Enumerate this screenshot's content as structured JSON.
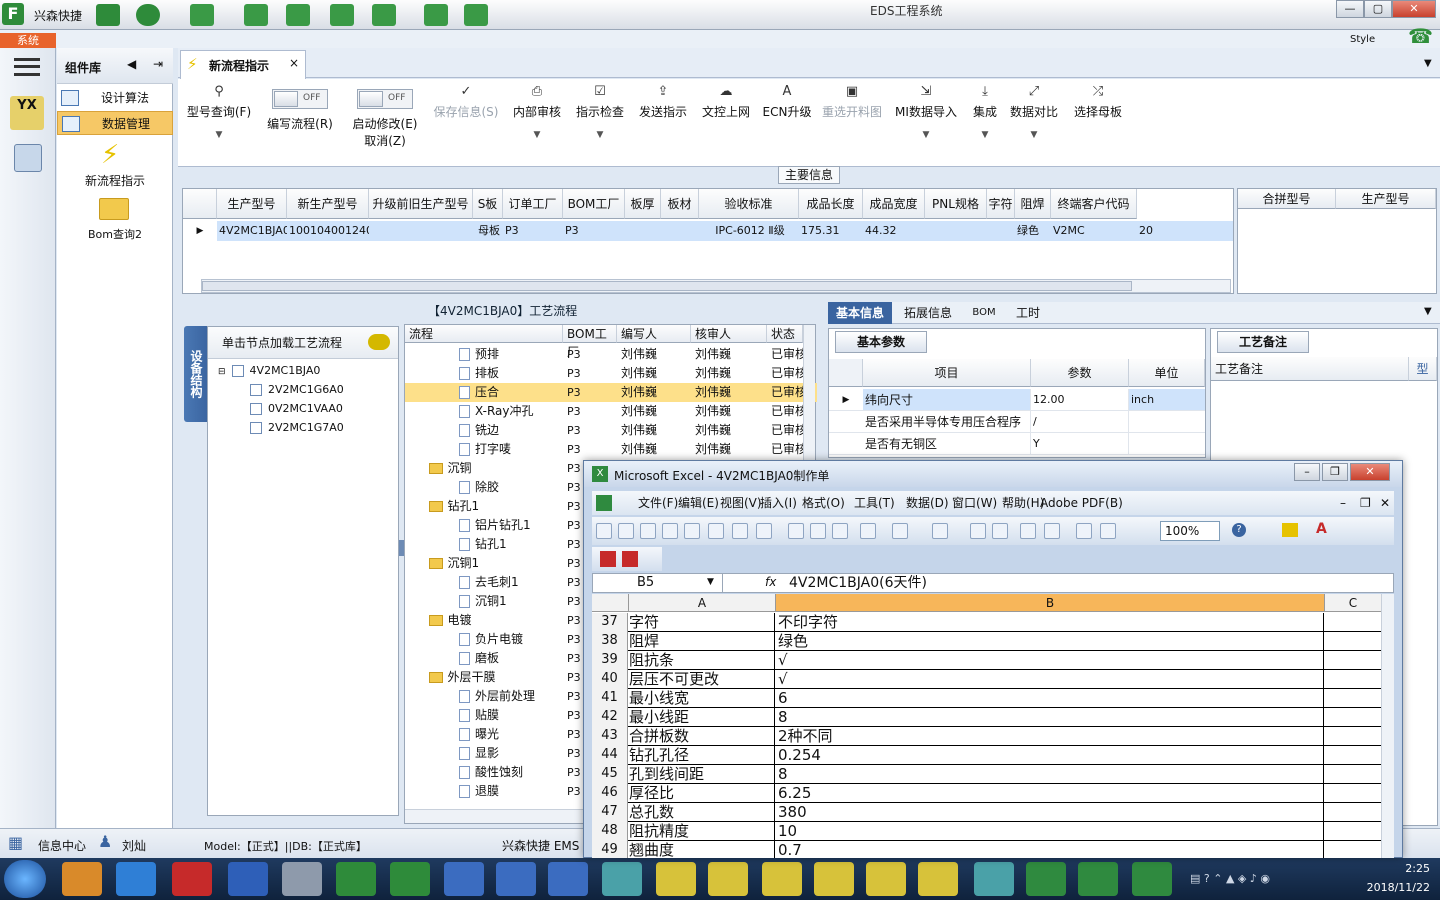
{
  "app": {
    "name": "兴森快捷",
    "window_title": "EDS工程系统",
    "system_menu": "系统",
    "style_label": "Style"
  },
  "window_controls": [
    "—",
    "▢",
    "✕"
  ],
  "sidebar": {
    "header": "组件库",
    "items": [
      {
        "label": "设计算法"
      },
      {
        "label": "数据管理"
      }
    ],
    "launchers": [
      {
        "label": "新流程指示"
      },
      {
        "label": "Bom查询2"
      }
    ]
  },
  "tab": {
    "label": "新流程指示",
    "close": "×"
  },
  "ribbon": {
    "buttons": [
      {
        "label": "型号查询(F)"
      },
      {
        "label": "编写流程(R)",
        "toggle": "OFF"
      },
      {
        "label": "启动修改(E)",
        "sub": "取消(Z)",
        "toggle": "OFF"
      },
      {
        "label": "保存信息(S)"
      },
      {
        "label": "内部审核"
      },
      {
        "label": "指示检查"
      },
      {
        "label": "发送指示"
      },
      {
        "label": "文控上网"
      },
      {
        "label": "ECN升级"
      },
      {
        "label": "重选开料图"
      },
      {
        "label": "MI数据导入"
      },
      {
        "label": "集成"
      },
      {
        "label": "数据对比"
      },
      {
        "label": "选择母板"
      }
    ]
  },
  "main_info": {
    "title": "主要信息",
    "columns": [
      "生产型号",
      "新生产型号",
      "升级前旧生产型号",
      "S板",
      "订单工厂",
      "BOM工厂",
      "板厚",
      "板材",
      "验收标准",
      "成品长度",
      "成品宽度",
      "PNL规格",
      "字符",
      "阻焊",
      "终端客户代码"
    ],
    "row": [
      "4V2MC1BJA0",
      "10010400124027",
      "",
      "母板",
      "P3",
      "P3",
      "",
      "",
      "IPC-6012 Ⅱ级",
      "175.31",
      "44.32",
      "",
      "",
      "绿色",
      "V2MC"
    ],
    "extra_cell": "20",
    "right_columns": [
      "合拼型号",
      "生产型号"
    ]
  },
  "process": {
    "title": "【4V2MC1BJA0】工艺流程",
    "side_tab": "设备结构",
    "hint": "单击节点加载工艺流程",
    "tree": {
      "root": "4V2MC1BJA0",
      "children": [
        "2V2MC1G6A0",
        "0V2MC1VAA0",
        "2V2MC1G7A0"
      ]
    },
    "columns": [
      "流程",
      "BOM工厂",
      "编写人",
      "核审人",
      "状态"
    ],
    "rows": [
      {
        "name": "预排",
        "level": 2,
        "type": "doc",
        "bom": "P3",
        "writer": "刘伟巍",
        "reviewer": "刘伟巍",
        "status": "已审核"
      },
      {
        "name": "排板",
        "level": 2,
        "type": "doc",
        "bom": "P3",
        "writer": "刘伟巍",
        "reviewer": "刘伟巍",
        "status": "已审核"
      },
      {
        "name": "压合",
        "level": 2,
        "type": "doc",
        "bom": "P3",
        "writer": "刘伟巍",
        "reviewer": "刘伟巍",
        "status": "已审核",
        "selected": true
      },
      {
        "name": "X-Ray冲孔",
        "level": 2,
        "type": "doc",
        "bom": "P3",
        "writer": "刘伟巍",
        "reviewer": "刘伟巍",
        "status": "已审核"
      },
      {
        "name": "铣边",
        "level": 2,
        "type": "doc",
        "bom": "P3",
        "writer": "刘伟巍",
        "reviewer": "刘伟巍",
        "status": "已审核"
      },
      {
        "name": "打字唛",
        "level": 2,
        "type": "doc",
        "bom": "P3",
        "writer": "刘伟巍",
        "reviewer": "刘伟巍",
        "status": "已审核"
      },
      {
        "name": "沉铜",
        "level": 1,
        "type": "folder",
        "bom": "P3",
        "writer": "",
        "reviewer": "",
        "status": ""
      },
      {
        "name": "除胶",
        "level": 2,
        "type": "doc",
        "bom": "P3",
        "writer": "",
        "reviewer": "",
        "status": ""
      },
      {
        "name": "钻孔1",
        "level": 1,
        "type": "folder",
        "bom": "P3",
        "writer": "",
        "reviewer": "",
        "status": ""
      },
      {
        "name": "铝片钻孔1",
        "level": 2,
        "type": "doc",
        "bom": "P3",
        "writer": "",
        "reviewer": "",
        "status": ""
      },
      {
        "name": "钻孔1",
        "level": 2,
        "type": "doc",
        "bom": "P3",
        "writer": "",
        "reviewer": "",
        "status": ""
      },
      {
        "name": "沉铜1",
        "level": 1,
        "type": "folder",
        "bom": "P3",
        "writer": "",
        "reviewer": "",
        "status": ""
      },
      {
        "name": "去毛刺1",
        "level": 2,
        "type": "doc",
        "bom": "P3",
        "writer": "",
        "reviewer": "",
        "status": ""
      },
      {
        "name": "沉铜1",
        "level": 2,
        "type": "doc",
        "bom": "P3",
        "writer": "",
        "reviewer": "",
        "status": ""
      },
      {
        "name": "电镀",
        "level": 1,
        "type": "folder",
        "bom": "P3",
        "writer": "",
        "reviewer": "",
        "status": ""
      },
      {
        "name": "负片电镀",
        "level": 2,
        "type": "doc",
        "bom": "P3",
        "writer": "",
        "reviewer": "",
        "status": ""
      },
      {
        "name": "磨板",
        "level": 2,
        "type": "doc",
        "bom": "P3",
        "writer": "",
        "reviewer": "",
        "status": ""
      },
      {
        "name": "外层干膜",
        "level": 1,
        "type": "folder",
        "bom": "P3",
        "writer": "",
        "reviewer": "",
        "status": ""
      },
      {
        "name": "外层前处理",
        "level": 2,
        "type": "doc",
        "bom": "P3",
        "writer": "",
        "reviewer": "",
        "status": ""
      },
      {
        "name": "贴膜",
        "level": 2,
        "type": "doc",
        "bom": "P3",
        "writer": "",
        "reviewer": "",
        "status": ""
      },
      {
        "name": "曝光",
        "level": 2,
        "type": "doc",
        "bom": "P3",
        "writer": "",
        "reviewer": "",
        "status": ""
      },
      {
        "name": "显影",
        "level": 2,
        "type": "doc",
        "bom": "P3",
        "writer": "",
        "reviewer": "",
        "status": ""
      },
      {
        "name": "酸性蚀刻",
        "level": 2,
        "type": "doc",
        "bom": "P3",
        "writer": "",
        "reviewer": "",
        "status": ""
      },
      {
        "name": "退膜",
        "level": 2,
        "type": "doc",
        "bom": "P3",
        "writer": "",
        "reviewer": "",
        "status": ""
      }
    ]
  },
  "right_panel": {
    "tabs": [
      "基本信息",
      "拓展信息",
      "BOM",
      "工时"
    ],
    "basic_title": "基本参数",
    "columns": [
      "项目",
      "参数",
      "单位"
    ],
    "rows": [
      {
        "item": "纬向尺寸",
        "param": "12.00",
        "unit": "inch"
      },
      {
        "item": "是否采用半导体专用压合程序",
        "param": "/",
        "unit": ""
      },
      {
        "item": "是否有无铜区",
        "param": "Y",
        "unit": ""
      }
    ],
    "remark_title": "工艺备注",
    "remark_header": "工艺备注",
    "remark_col2": "型"
  },
  "status_bar": {
    "info": "信息中心",
    "user": "刘灿",
    "model": "Model:【正式】||DB:【正式库】",
    "brand": "兴森快捷 EMS"
  },
  "excel": {
    "title": "Microsoft Excel - 4V2MC1BJA0制作单",
    "menu": [
      "文件(F)",
      "编辑(E)",
      "视图(V)",
      "插入(I)",
      "格式(O)",
      "工具(T)",
      "数据(D)",
      "窗口(W)",
      "帮助(H)",
      "Adobe PDF(B)"
    ],
    "zoom": "100%",
    "cell_ref": "B5",
    "formula": "4V2MC1BJA0(6天件)",
    "col_headers": [
      "A",
      "B",
      "C"
    ],
    "rows": [
      {
        "n": "37",
        "a": "字符",
        "b": "不印字符"
      },
      {
        "n": "38",
        "a": "阻焊",
        "b": "绿色"
      },
      {
        "n": "39",
        "a": "阻抗条",
        "b": "√"
      },
      {
        "n": "40",
        "a": "层压不可更改",
        "b": "√"
      },
      {
        "n": "41",
        "a": "最小线宽",
        "b": "6"
      },
      {
        "n": "42",
        "a": "最小线距",
        "b": "8"
      },
      {
        "n": "43",
        "a": "合拼板数",
        "b": "2种不同"
      },
      {
        "n": "44",
        "a": "钻孔孔径",
        "b": "0.254"
      },
      {
        "n": "45",
        "a": "孔到线间距",
        "b": "8"
      },
      {
        "n": "46",
        "a": "厚径比",
        "b": "6.25"
      },
      {
        "n": "47",
        "a": "总孔数",
        "b": "380"
      },
      {
        "n": "48",
        "a": "阻抗精度",
        "b": "10"
      },
      {
        "n": "49",
        "a": "翘曲度",
        "b": "0.7"
      }
    ]
  },
  "taskbar": {
    "time": "2:25",
    "date": "2018/11/22"
  },
  "colors": {
    "accent": "#3a64a0",
    "selected_row": "#fde08a",
    "excel_col_b": "#f7b65a",
    "system_btn": "#e8632b"
  }
}
